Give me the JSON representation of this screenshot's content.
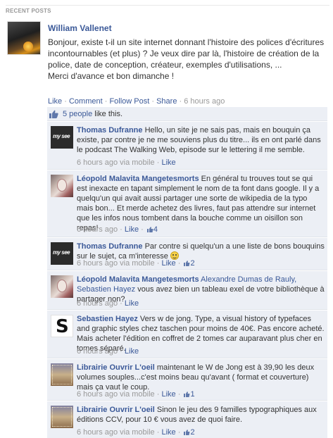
{
  "section_title": "RECENT POSTS",
  "post": {
    "author": "William Vallenet",
    "body": "Bonjour, existe t-il un site internet donnant l'histoire des polices d'écritures incontournables (et plus) ? Je veux dire par là, l'histoire de création de la police, date de conception, créateur, exemples d'utilisations, ...\nMerci d'avance et bon dimanche !",
    "actions": {
      "like": "Like",
      "comment": "Comment",
      "follow": "Follow Post",
      "share": "Share",
      "sep": " · "
    },
    "time": "6 hours ago"
  },
  "likes": {
    "count_text": "5 people",
    "suffix": " like this."
  },
  "comments": [
    {
      "author": "Thomas Dufranne",
      "avatar": "mysee-logo",
      "text": "Hello, un site je ne sais pas, mais en bouquin ça existe, par contre je ne me souviens plus du titre... ils en ont parlé dans le podcast The Walking Web, episode sur le lettering il me semble.",
      "time": "6 hours ago via mobile",
      "like": "Like",
      "like_count": ""
    },
    {
      "author": "Léopold Malavita Mangetesmorts",
      "avatar": "leopold-photo",
      "text": "En général tu trouves tout se qui est inexacte en tapant simplement le nom de ta font dans google. Il y a quelqu'un qui avait aussi partager une sorte de wikipedia de la typo mais bon... Et merde achetez des livres, faut pas attendre sur internet que les infos nous tombent dans la bouche comme un oisillon son repas!",
      "time": "6 hours ago",
      "like": "Like",
      "like_count": "4"
    },
    {
      "author": "Thomas Dufranne",
      "avatar": "mysee-logo",
      "text": "Par contre si quelqu'un a une liste de bons bouquins sur le sujet, ca m'interesse",
      "time": "6 hours ago via mobile",
      "like": "Like",
      "like_count": "2"
    },
    {
      "author": "Léopold Malavita Mangetesmorts",
      "avatar": "leopold-photo",
      "tags": "Alexandre Dumas de Rauly, Sebastien Hayez",
      "text": "vous avez bien un tableau exel de votre bibliothèque à partager non?",
      "time": "6 hours ago",
      "like": "Like",
      "like_count": ""
    },
    {
      "author": "Sebastien Hayez",
      "avatar": "s-logo",
      "text": "Vers w de jong. Type, a visual history of typefaces and graphic styles chez taschen pour moins de 40€. Pas encore acheté. Mais acheter l'édition en coffret de 2 tomes car auparavant plus cher en tomes séparé.",
      "time": "6 hours ago",
      "like": "Like",
      "like_count": ""
    },
    {
      "author": "Librairie Ouvrir L'oeil",
      "avatar": "librairie-photo",
      "text": "maintenant le W de Jong est à 39,90 les deux volumes souples...c'est moins beau qu'avant ( format et couverture) mais ça vaut le coup.",
      "time": "6 hours ago via mobile",
      "like": "Like",
      "like_count": "1"
    },
    {
      "author": "Librairie Ouvrir L'oeil",
      "avatar": "librairie-photo",
      "text": "Sinon le jeu des 9 familles typographiques aux éditions CCV, pour 10 € vous avez de quoi faire.",
      "time": "6 hours ago via mobile",
      "like": "Like",
      "like_count": "2"
    }
  ],
  "colors": {
    "link": "#3b5998",
    "meta": "#999999",
    "comment_bg": "#eceff5"
  }
}
